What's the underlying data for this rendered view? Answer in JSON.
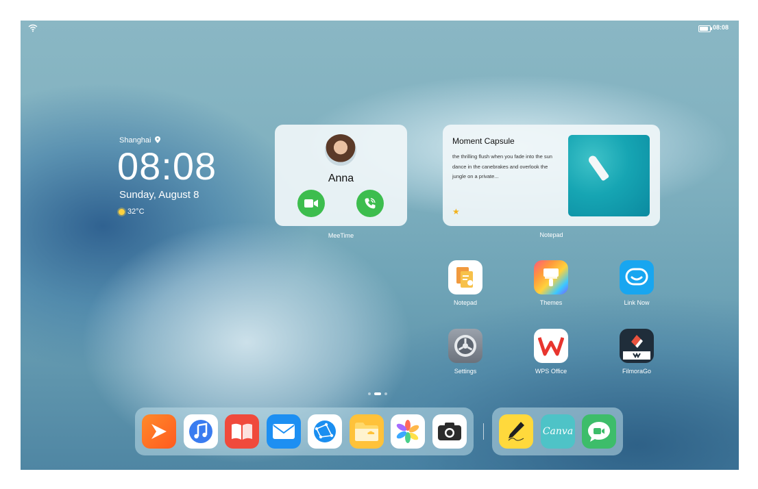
{
  "status_bar": {
    "time": "08:08"
  },
  "clock_widget": {
    "city": "Shanghai",
    "time": "08:08",
    "date": "Sunday, August 8",
    "temperature": "32°C"
  },
  "meetime_widget": {
    "contact_name": "Anna",
    "label": "MeeTime",
    "call_color": "#3dbd4e"
  },
  "notepad_widget": {
    "title": "Moment Capsule",
    "body": "the thrilling flush when you fade into the sun dance in the canebrakes and overlook the jungle on a private...",
    "label": "Notepad",
    "star_color": "#f2b21c"
  },
  "apps": [
    {
      "label": "Notepad",
      "icon": "notepad-icon"
    },
    {
      "label": "Themes",
      "icon": "themes-icon"
    },
    {
      "label": "Link Now",
      "icon": "link-now-icon"
    },
    {
      "label": "Settings",
      "icon": "settings-icon"
    },
    {
      "label": "WPS Office",
      "icon": "wps-office-icon"
    },
    {
      "label": "FilmoraGo",
      "icon": "filmorago-icon"
    }
  ],
  "page_indicator": {
    "pages": 3,
    "current": 2
  },
  "dock": {
    "main": [
      "video-icon",
      "music-icon",
      "books-icon",
      "email-icon",
      "browser-icon",
      "files-icon",
      "gallery-icon",
      "camera-icon"
    ],
    "recent": [
      "notes-pen-icon",
      "canva-icon",
      "meetime-icon"
    ],
    "canva_text": "Canva"
  }
}
